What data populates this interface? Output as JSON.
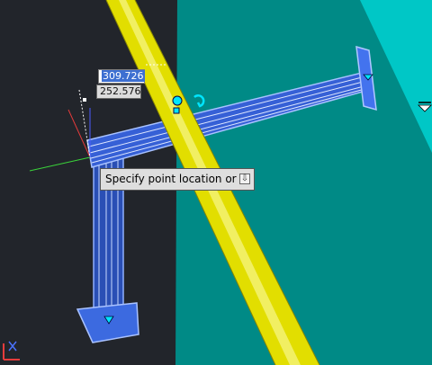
{
  "dynamic_input": {
    "x_value": "309.726",
    "y_value": "252.576"
  },
  "tooltip": {
    "prompt": "Specify point location or",
    "options_icon": "⇩"
  },
  "icons": {
    "osnap": "snap-marker-icon",
    "grip": "grip-icon",
    "ucs": "ucs-icon"
  },
  "colors": {
    "background": "#22252b",
    "plane": "#008b88",
    "wall": "#00c6c5",
    "pipe": "#e8e400",
    "steel": "#5a86f5",
    "snap": "#00e5ff"
  }
}
